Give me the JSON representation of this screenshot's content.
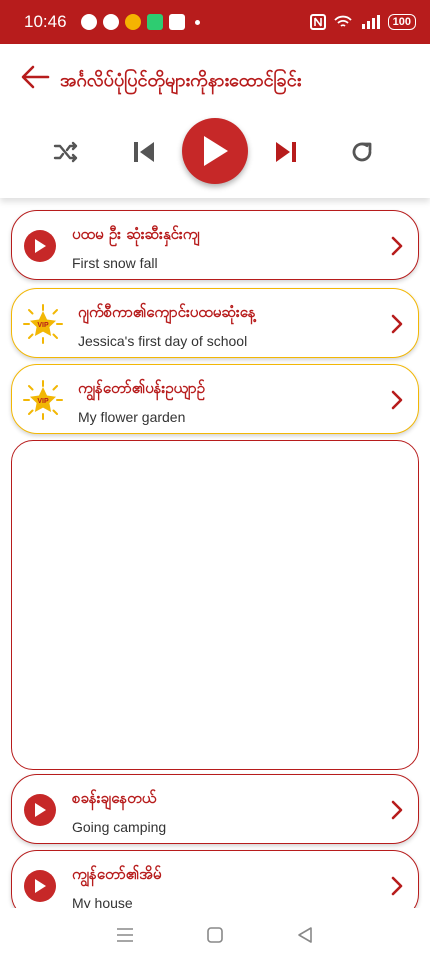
{
  "status_bar": {
    "time": "10:46",
    "battery": "100"
  },
  "header": {
    "title": "အင်္ဂလိပ်ပုံပြင်တိုများကိုနားထောင်ခြင်း"
  },
  "playlist": [
    {
      "title": "ပထမ ဦး ဆုံးဆီးနှင်းကျ",
      "subtitle": "First snow fall",
      "vip": false
    },
    {
      "title": "ဂျက်စီကာ၏ကျောင်းပထမဆုံးနေ့",
      "subtitle": "Jessica's first day of school",
      "vip": true
    },
    {
      "title": "ကျွန်တော်၏ပန်းဥယျာဉ်",
      "subtitle": "My flower garden",
      "vip": true
    },
    {
      "title": "စခန်းချနေတယ်",
      "subtitle": "Going camping",
      "vip": false
    },
    {
      "title": "ကျွန်တော်၏အိမ်",
      "subtitle": "My house",
      "vip": false
    }
  ],
  "vip_badge": "VIP",
  "colors": {
    "primary": "#b71c1c",
    "play": "#c62828",
    "vip_border": "#f2b705"
  }
}
